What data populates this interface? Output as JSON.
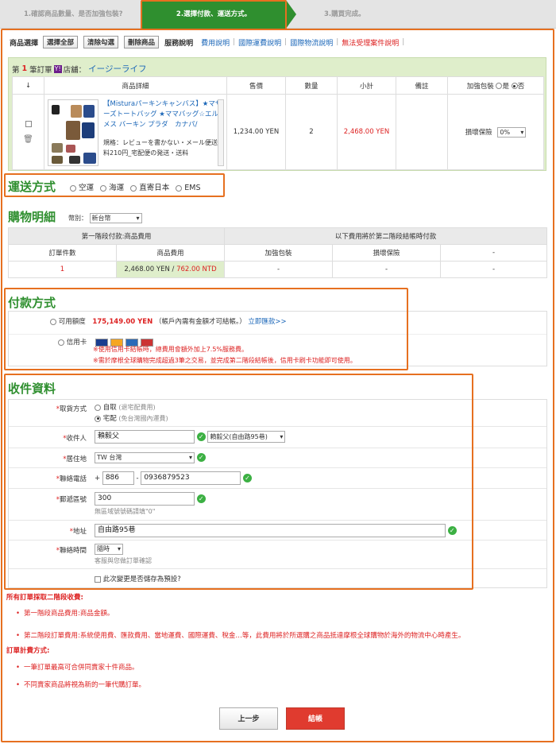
{
  "steps": {
    "step1": "1.確認商品數量、是否加強包裝?",
    "step2": "2.選擇付款、運送方式。",
    "step3": "3.購買完成。"
  },
  "toolbar": {
    "label": "商品選擇",
    "select_all": "選擇全部",
    "clear": "清除勾選",
    "delete": "刪除商品",
    "service_label": "服務說明",
    "links": [
      "費用說明",
      "國際運費說明",
      "國際物流說明",
      "無法受理案件說明"
    ]
  },
  "shop": {
    "prefix": "第",
    "count": "1",
    "suffix": "筆訂單",
    "y": "Y!",
    "label": "店舖：",
    "name": "イージーライフ"
  },
  "cart_headers": [
    "↓",
    "商品詳細",
    "售價",
    "數量",
    "小計",
    "備註"
  ],
  "pack": {
    "label": "加強包裝",
    "yes": "是",
    "no": "否"
  },
  "item": {
    "title": "【Misturaパーキンキャンバス】★マザーズトートバッグ ★ママバッグ☆エルメス バーキン プラダ　カナパ/",
    "spec": "規格：レビューを書かない・メール便送料210円_宅配便の発送・送料",
    "price": "1,234.00 YEN",
    "qty": "2",
    "subtotal": "2,468.00 YEN",
    "insurance_label": "損壞保險",
    "insurance_value": "0%"
  },
  "shipping": {
    "title": "運送方式",
    "options": [
      "空運",
      "海運",
      "直寄日本",
      "EMS"
    ]
  },
  "details": {
    "title": "購物明細",
    "currency_label": "幣別：",
    "currency_value": "新台幣",
    "h_phase1": "第一階段付款:商品費用",
    "h_phase2": "以下費用將於第二階段結帳時付款",
    "cols": [
      "訂單件數",
      "商品費用",
      "加強包裝",
      "損壞保險",
      "-"
    ],
    "row": {
      "count": "1",
      "fee_yen": "2,468.00 YEN",
      "sep": " / ",
      "fee_ntd": "762.00 NTD",
      "pack": "-",
      "ins": "-",
      "other": "-"
    }
  },
  "payment": {
    "title": "付款方式",
    "credit_label": "可用額度",
    "credit_amount": "175,149.00 YEN",
    "credit_note": "（帳戶內需有金額才可結帳。）",
    "credit_link": "立即匯款>>",
    "card_label": "信用卡",
    "note1": "※使用信用卡結帳時，總費用會額外加上7.5%服務費。",
    "note2": "※需於摩根全球購物完成超過3筆之交易，並完成第二階段結帳後，信用卡刷卡功能即可使用。"
  },
  "receiver": {
    "title": "收件資料",
    "method_label": "取貨方式",
    "method_self": "自取",
    "method_self_hint": "(退宅配費用)",
    "method_home": "宅配",
    "method_home_hint": "(免台灣國內運費)",
    "name_label": "收件人",
    "name_value": "賴毅父",
    "name_select": "賴毅父(自由路95巷)",
    "area_label": "居住地",
    "area_value": "TW 台灣",
    "phone_label": "聯絡電話",
    "phone_plus": "+",
    "phone_cc": "886",
    "phone_dash": "-",
    "phone_num": "0936879523",
    "zip_label": "郵遞區號",
    "zip_value": "300",
    "zip_hint": "無區域號號碼請填\"0\"",
    "addr_label": "地址",
    "addr_value": "自由路95巷",
    "time_label": "聯絡時間",
    "time_value": "隨時",
    "time_hint": "客服與您做訂單確認",
    "default_label": "此次變更是否儲存為預設?"
  },
  "rules": {
    "h1": "所有訂單採取二階段收費:",
    "l1": "第一階段商品費用:商品金額。",
    "l2": "第二階段訂單費用:系統使用費、匯款費用、當地運費、國際運費、稅金…等，此費用將於所選購之商品抵達摩根全球購物於海外的物流中心時產生。",
    "h2": "訂單計費方式:",
    "l3": "一筆訂單最高可合併同賣家十件商品。",
    "l4": "不同賣家商品將視為新的一筆代購訂單。"
  },
  "buttons": {
    "prev": "上一步",
    "checkout": "結帳"
  },
  "colors": {
    "accent_green": "#2f8f2f",
    "highlight_orange": "#e67020",
    "alert_red": "#d22",
    "link_blue": "#1a66b8"
  }
}
